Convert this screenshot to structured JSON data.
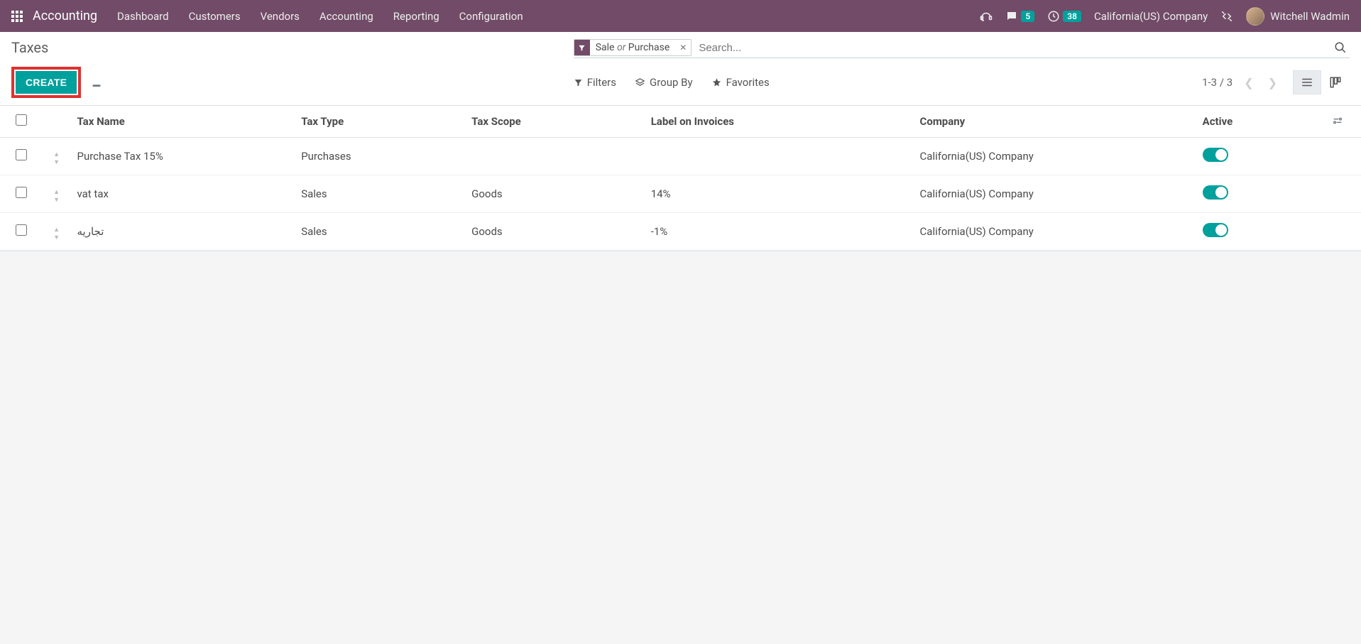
{
  "nav": {
    "app": "Accounting",
    "menus": [
      "Dashboard",
      "Customers",
      "Vendors",
      "Accounting",
      "Reporting",
      "Configuration"
    ],
    "msg_count": "5",
    "clock_count": "38",
    "company": "California(US) Company",
    "user": "Witchell Wadmin"
  },
  "page": {
    "title": "Taxes",
    "create": "CREATE"
  },
  "search": {
    "facet_a": "Sale",
    "facet_or": "or",
    "facet_b": "Purchase",
    "placeholder": "Search...",
    "filters": "Filters",
    "groupby": "Group By",
    "favorites": "Favorites"
  },
  "pager": {
    "range": "1-3 / 3"
  },
  "columns": {
    "name": "Tax Name",
    "type": "Tax Type",
    "scope": "Tax Scope",
    "label": "Label on Invoices",
    "company": "Company",
    "active": "Active"
  },
  "rows": [
    {
      "name": "Purchase Tax 15%",
      "type": "Purchases",
      "scope": "",
      "label": "",
      "company": "California(US) Company",
      "active": true
    },
    {
      "name": "vat tax",
      "type": "Sales",
      "scope": "Goods",
      "label": "14%",
      "company": "California(US) Company",
      "active": true
    },
    {
      "name": "تجاريه",
      "type": "Sales",
      "scope": "Goods",
      "label": "-1%",
      "company": "California(US) Company",
      "active": true
    }
  ]
}
